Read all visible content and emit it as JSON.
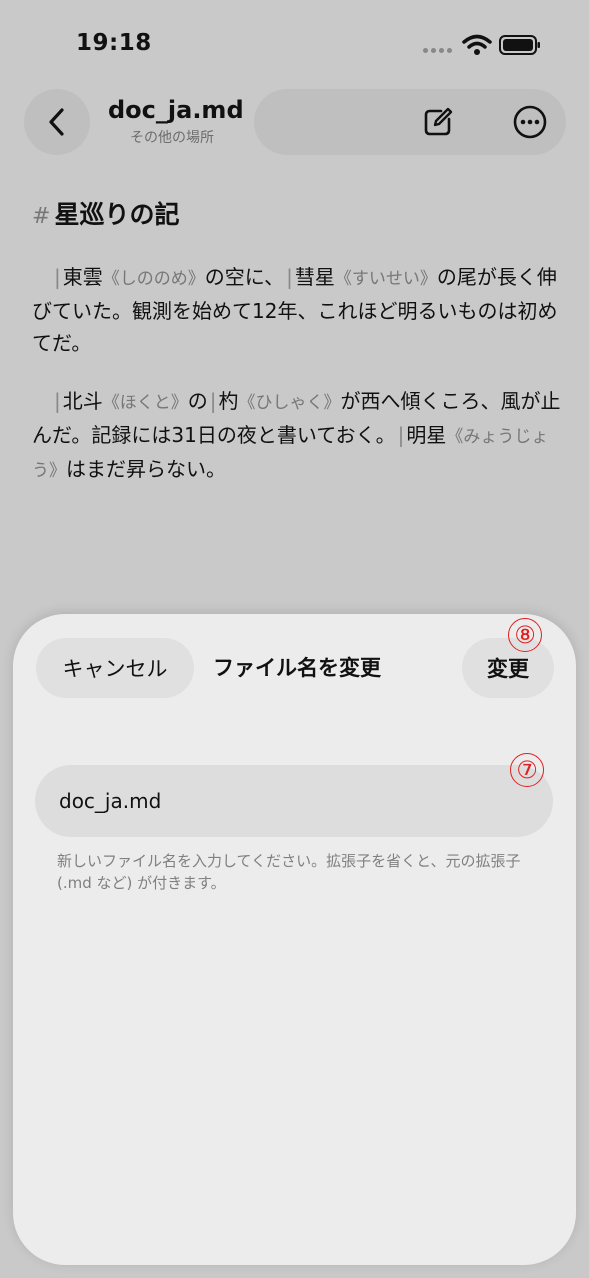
{
  "status": {
    "time": "19:18"
  },
  "header": {
    "title": "doc_ja.md",
    "subtitle": "その他の場所"
  },
  "icons": {
    "back": "chevron-left-icon",
    "edit": "compose-icon",
    "more": "more-circle-icon",
    "wifi": "wifi-icon",
    "battery": "battery-icon"
  },
  "document": {
    "heading_marker": "#",
    "heading": "星巡りの記",
    "para1": {
      "bar1": "|",
      "w1": "東雲",
      "r1": "《しののめ》",
      "t1": "の空に、",
      "bar2": "|",
      "w2": "彗星",
      "r2": "《すいせい》",
      "t2": "の尾が長く伸びていた。観測を始めて12年、これほど明るいものは初めてだ。"
    },
    "para2": {
      "bar1": "|",
      "w1": "北斗",
      "r1": "《ほくと》",
      "t1": "の",
      "bar2": "|",
      "w2": "杓",
      "r2": "《ひしゃく》",
      "t2": "が西へ傾くころ、風が止んだ。記録には31日の夜と書いておく。",
      "bar3": "|",
      "w3": "明星",
      "r3": "《みょうじょう》",
      "t3": "はまだ昇らない。"
    }
  },
  "sheet": {
    "cancel_label": "キャンセル",
    "title": "ファイル名を変更",
    "confirm_label": "変更",
    "badge_confirm": "⑧",
    "badge_field": "⑦",
    "filename_value": "doc_ja.md",
    "hint": "新しいファイル名を入力してください。拡張子を省くと、元の拡張子 (.md など) が付きます。"
  },
  "colors": {
    "badge": "#e02020",
    "background": "#c9c9c9",
    "sheet": "#ececec"
  }
}
